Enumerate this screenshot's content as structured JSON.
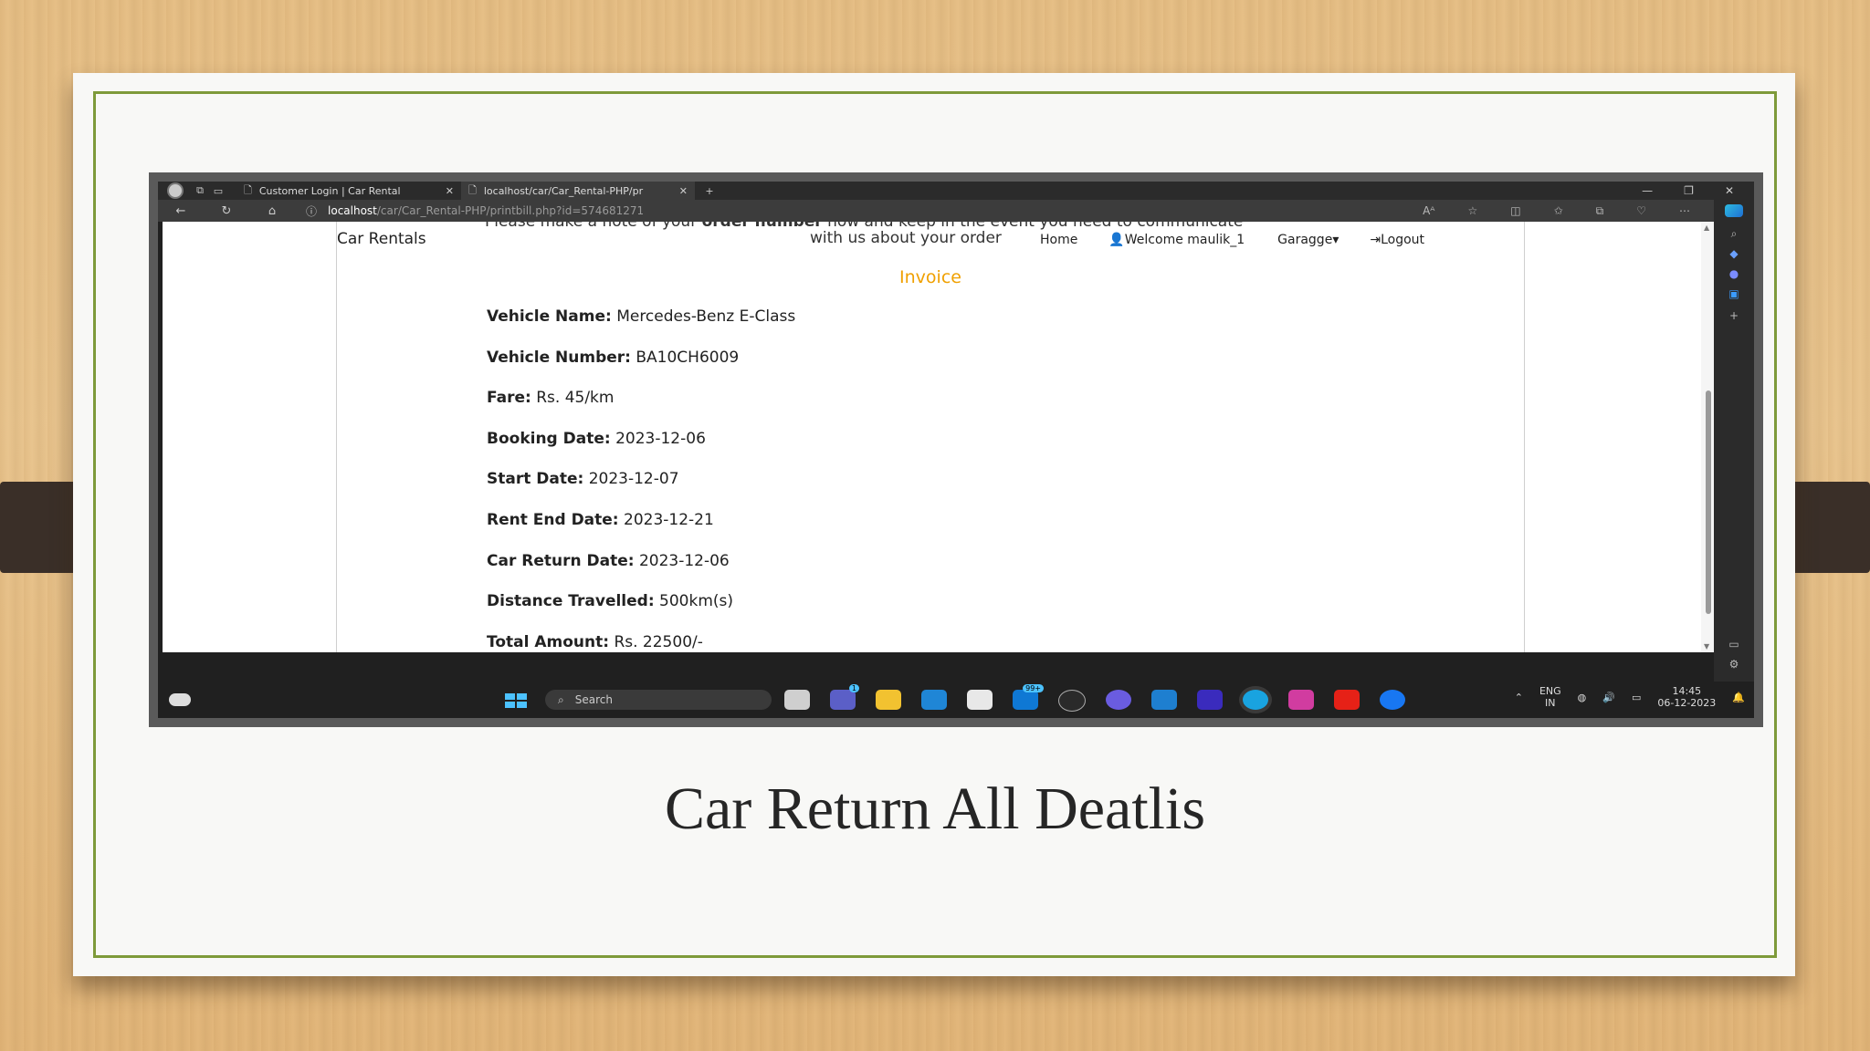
{
  "slide": {
    "caption": "Car Return All Deatlis"
  },
  "browser": {
    "tabs": [
      {
        "title": "Customer Login | Car Rental",
        "active": false
      },
      {
        "title": "localhost/car/Car_Rental-PHP/pr",
        "active": true
      }
    ],
    "new_tab": "+",
    "url_host": "localhost",
    "url_path": "/car/Car_Rental-PHP/printbill.php?id=574681271"
  },
  "site": {
    "brand": "Car Rentals",
    "note_top_line": "Please make a note of your order number now and keep in the event you need to communicate",
    "note_bold": "order number",
    "note_bottom_line": "with us about your order",
    "nav": {
      "home": "Home",
      "welcome": "Welcome maulik_1",
      "garage": "Garagge",
      "logout": "Logout"
    },
    "heading": "Invoice"
  },
  "invoice": [
    {
      "label": "Vehicle Name:",
      "value": "Mercedes-Benz E-Class"
    },
    {
      "label": "Vehicle Number:",
      "value": "BA10CH6009"
    },
    {
      "label": "Fare:",
      "value": " Rs. 45/km"
    },
    {
      "label": "Booking Date:",
      "value": "2023-12-06"
    },
    {
      "label": "Start Date:",
      "value": "2023-12-07"
    },
    {
      "label": "Rent End Date:",
      "value": "2023-12-21"
    },
    {
      "label": "Car Return Date:",
      "value": "2023-12-06"
    },
    {
      "label": "Distance Travelled:",
      "value": "500km(s)"
    },
    {
      "label": "Total Amount:",
      "value": "Rs. 22500/-"
    }
  ],
  "taskbar": {
    "search_placeholder": "Search",
    "lang_top": "ENG",
    "lang_bottom": "IN",
    "time": "14:45",
    "date": "06-12-2023",
    "badges": {
      "teams": "1",
      "mail": "99+"
    }
  },
  "colors": {
    "invoice_heading": "#f0a000",
    "slide_border": "#7e9a3a",
    "taskbar": "#202020"
  }
}
